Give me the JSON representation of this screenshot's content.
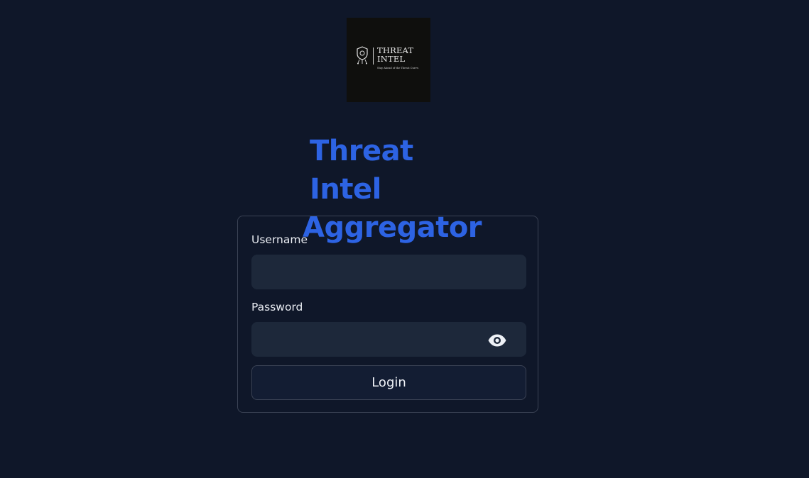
{
  "logo": {
    "line1": "THREAT",
    "line2": "INTEL",
    "tagline": "Stay Ahead of the Threat Curve.",
    "icon": "shield-circuit-icon"
  },
  "title": {
    "line1": "Threat Intel",
    "line2": "Aggregator"
  },
  "form": {
    "username_label": "Username",
    "username_value": "",
    "password_label": "Password",
    "password_value": "",
    "password_toggle_icon": "eye-icon",
    "login_label": "Login"
  },
  "colors": {
    "background": "#0f1729",
    "accent": "#2d63e3",
    "input_bg": "#1d283a",
    "border": "#3a4254"
  }
}
